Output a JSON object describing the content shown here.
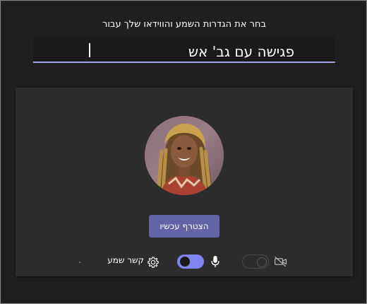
{
  "prompt": "בחר את הגדרות השמע והווידאו שלך עבור",
  "meeting": {
    "title": "פגישה עם גב' אש"
  },
  "join": {
    "label": "הצטרף עכשיו"
  },
  "controls": {
    "audio_label": "קשר שמע",
    "mic_enabled": true,
    "camera_enabled": false
  },
  "colors": {
    "background": "#201f1f",
    "panel": "#2d2c2c",
    "accent": "#6264a7",
    "toggle_on": "#7f85f5",
    "field_underline": "#9ea2d8"
  },
  "icons": [
    "settings-gear-icon",
    "microphone-icon",
    "camera-off-icon",
    "avatar-photo"
  ]
}
